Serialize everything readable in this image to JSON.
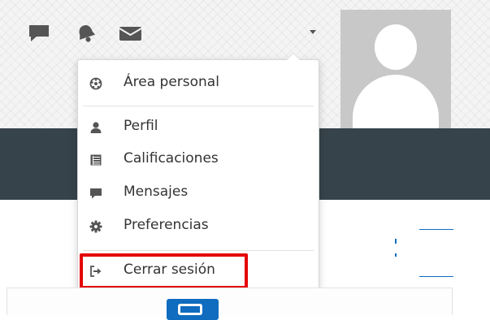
{
  "header": {
    "icons": {
      "chat": "chat-bubble-icon",
      "notifications": "bell-icon",
      "messages": "envelope-icon",
      "caret": "caret-down-icon"
    },
    "user_name": "",
    "avatar": "user-avatar-placeholder"
  },
  "user_menu": {
    "items": [
      {
        "label": "Área personal",
        "icon": "dashboard-icon"
      },
      {
        "label": "Perfil",
        "icon": "user-icon"
      },
      {
        "label": "Calificaciones",
        "icon": "table-icon"
      },
      {
        "label": "Mensajes",
        "icon": "chat-bubble-icon"
      },
      {
        "label": "Preferencias",
        "icon": "gear-icon"
      },
      {
        "label": "Cerrar sesión",
        "icon": "sign-out-icon"
      }
    ]
  },
  "colors": {
    "navbar": "#37434b",
    "link": "#0f6cbf",
    "highlight": "#e50000",
    "icon": "#555555"
  }
}
